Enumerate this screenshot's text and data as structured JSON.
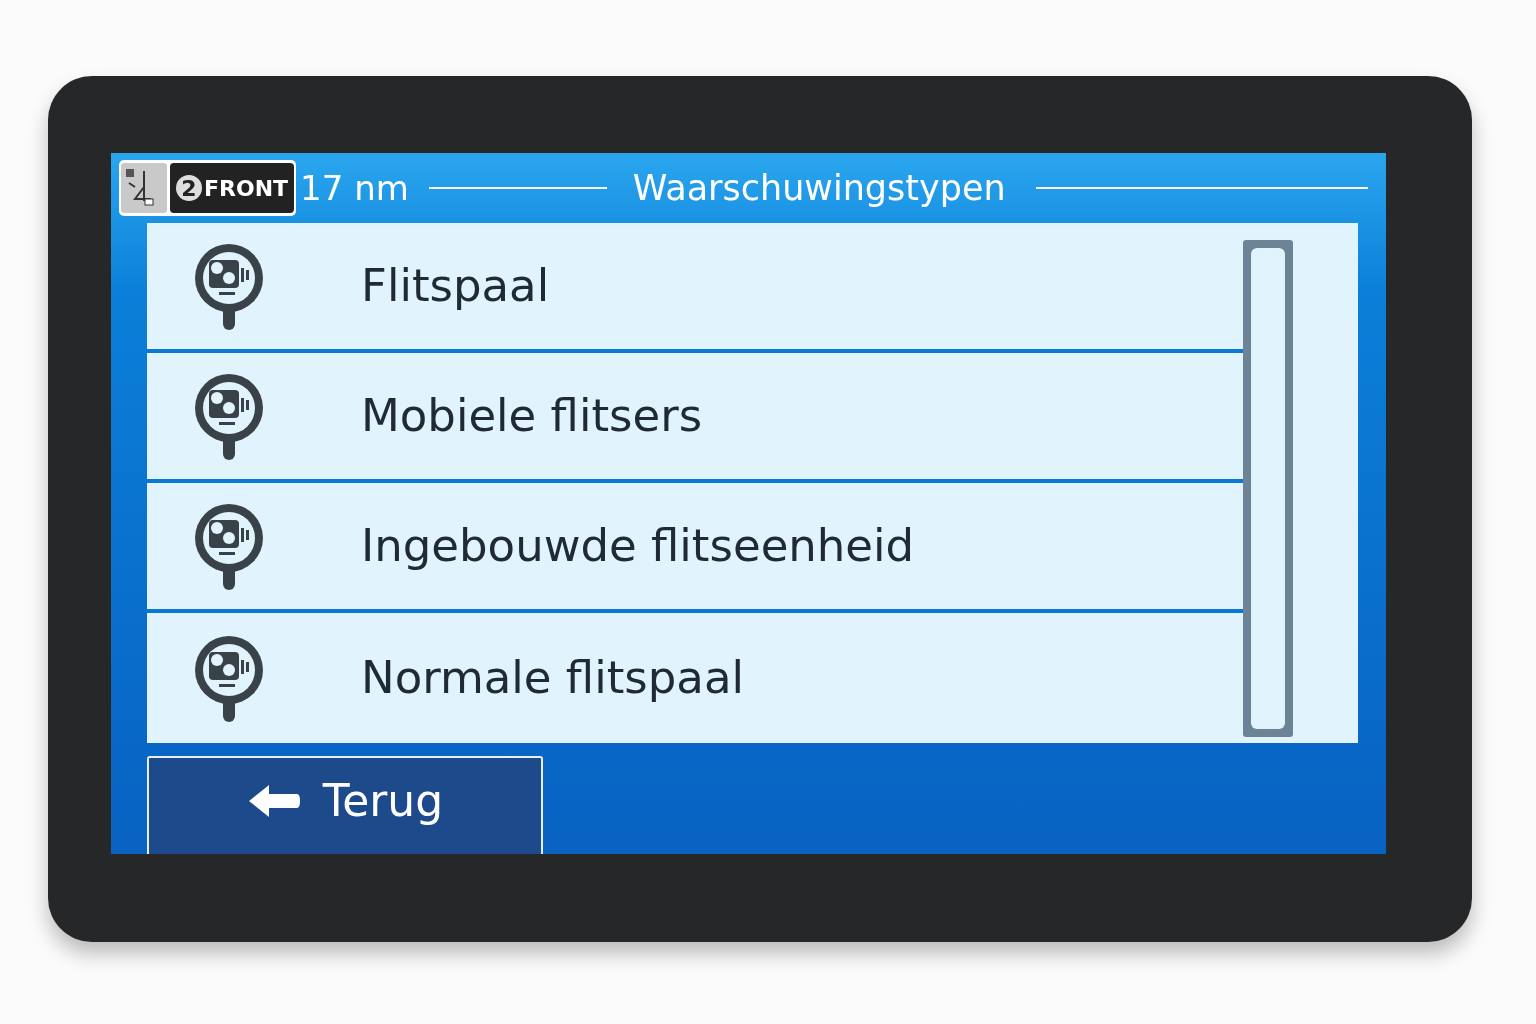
{
  "header": {
    "badge": {
      "number": "2",
      "text": "FRONT"
    },
    "distance": "17 nm",
    "title": "Waarschuwingstypen"
  },
  "items": [
    {
      "label": "Flitspaal"
    },
    {
      "label": "Mobiele flitsers"
    },
    {
      "label": "Ingebouwde flitseenheid"
    },
    {
      "label": "Normale flitspaal"
    }
  ],
  "back_button": {
    "label": "Terug"
  }
}
